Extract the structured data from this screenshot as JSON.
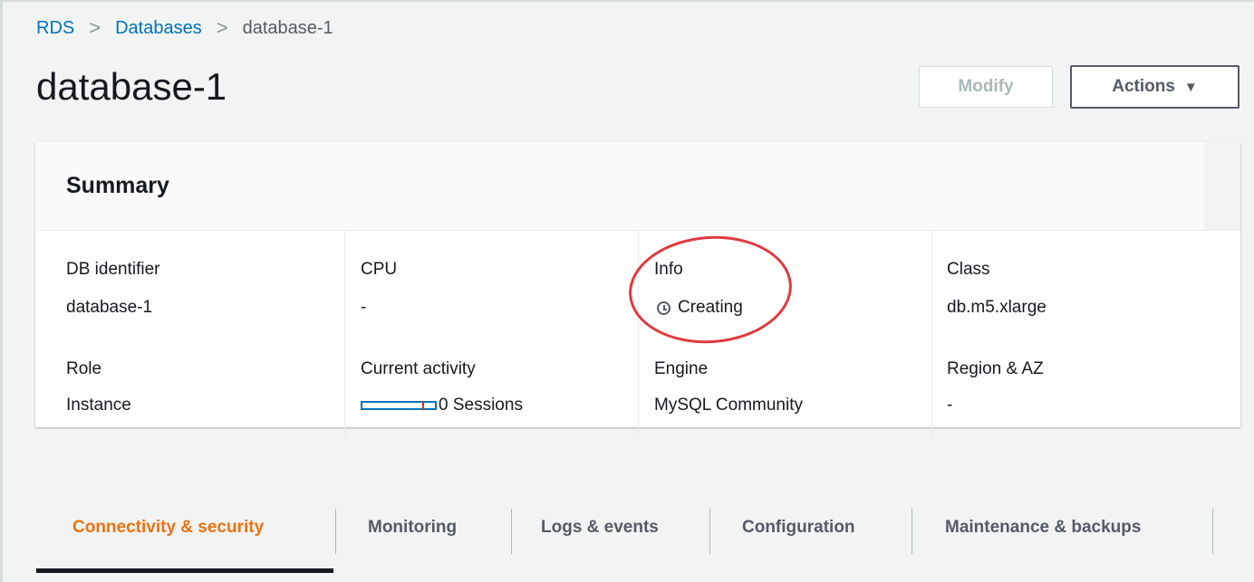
{
  "breadcrumb": {
    "items": [
      "RDS",
      "Databases"
    ],
    "current": "database-1"
  },
  "page": {
    "title": "database-1"
  },
  "toolbar": {
    "modify_label": "Modify",
    "actions_label": "Actions",
    "actions_caret": "▼"
  },
  "summary": {
    "title": "Summary",
    "db_identifier": {
      "label": "DB identifier",
      "value": "database-1"
    },
    "role": {
      "label": "Role",
      "value": "Instance"
    },
    "cpu": {
      "label": "CPU",
      "value": "-"
    },
    "current_activity": {
      "label": "Current activity",
      "value": "0 Sessions"
    },
    "info": {
      "label": "Info",
      "value": "Creating"
    },
    "engine": {
      "label": "Engine",
      "value": "MySQL Community"
    },
    "class": {
      "label": "Class",
      "value": "db.m5.xlarge"
    },
    "region_az": {
      "label": "Region & AZ",
      "value": "-"
    }
  },
  "tabs": [
    {
      "label": "Connectivity & security",
      "active": true
    },
    {
      "label": "Monitoring"
    },
    {
      "label": "Logs & events"
    },
    {
      "label": "Configuration"
    },
    {
      "label": "Maintenance & backups"
    }
  ],
  "colors": {
    "link": "#0073bb",
    "active_tab": "#ec7211",
    "highlight_circle": "#e0393e",
    "status_grey": "#687078"
  },
  "icons": {
    "status": "clock-icon",
    "actions": "caret-down-icon"
  }
}
